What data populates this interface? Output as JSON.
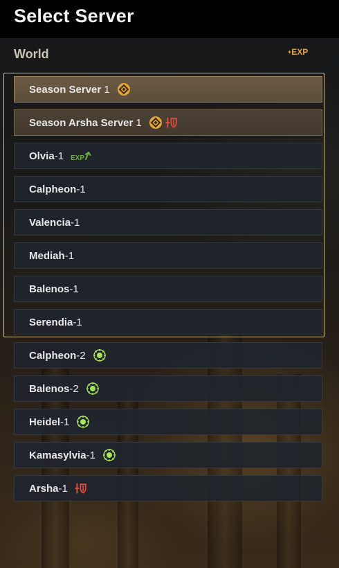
{
  "header": {
    "title": "Select Server"
  },
  "world": {
    "label": "World",
    "exp_tag": "EXP"
  },
  "colors": {
    "accent_gold": "#e2a63a",
    "season_row": "#5e4f3d",
    "exp_green": "#6fae3b",
    "pvp_red": "#e34a3a",
    "hot_green": "#a8e35a"
  },
  "servers": [
    {
      "name": "Season Server",
      "sep": " ",
      "num": "1",
      "style": "season",
      "icons": [
        "season-icon"
      ]
    },
    {
      "name": "Season Arsha Server",
      "sep": " ",
      "num": "1",
      "style": "season2",
      "icons": [
        "season-icon",
        "pvp-icon"
      ]
    },
    {
      "name": "Olvia",
      "sep": "-",
      "num": "1",
      "style": "normal",
      "icons": [
        "exp-boost-icon"
      ]
    },
    {
      "name": "Calpheon",
      "sep": "-",
      "num": "1",
      "style": "normal",
      "icons": []
    },
    {
      "name": "Valencia",
      "sep": "-",
      "num": "1",
      "style": "normal",
      "icons": []
    },
    {
      "name": "Mediah",
      "sep": "-",
      "num": "1",
      "style": "normal",
      "icons": []
    },
    {
      "name": "Balenos",
      "sep": "-",
      "num": "1",
      "style": "normal",
      "icons": []
    },
    {
      "name": "Serendia",
      "sep": "-",
      "num": "1",
      "style": "normal",
      "icons": []
    },
    {
      "name": "Calpheon",
      "sep": "-",
      "num": "2",
      "style": "normal",
      "icons": [
        "spark-icon"
      ]
    },
    {
      "name": "Balenos",
      "sep": "-",
      "num": "2",
      "style": "normal",
      "icons": [
        "spark-icon"
      ]
    },
    {
      "name": "Heidel",
      "sep": "-",
      "num": "1",
      "style": "normal",
      "icons": [
        "spark-icon"
      ]
    },
    {
      "name": "Kamasylvia",
      "sep": "-",
      "num": "1",
      "style": "normal",
      "icons": [
        "spark-icon"
      ]
    },
    {
      "name": "Arsha",
      "sep": "-",
      "num": "1",
      "style": "normal",
      "icons": [
        "pvp-icon"
      ]
    }
  ]
}
